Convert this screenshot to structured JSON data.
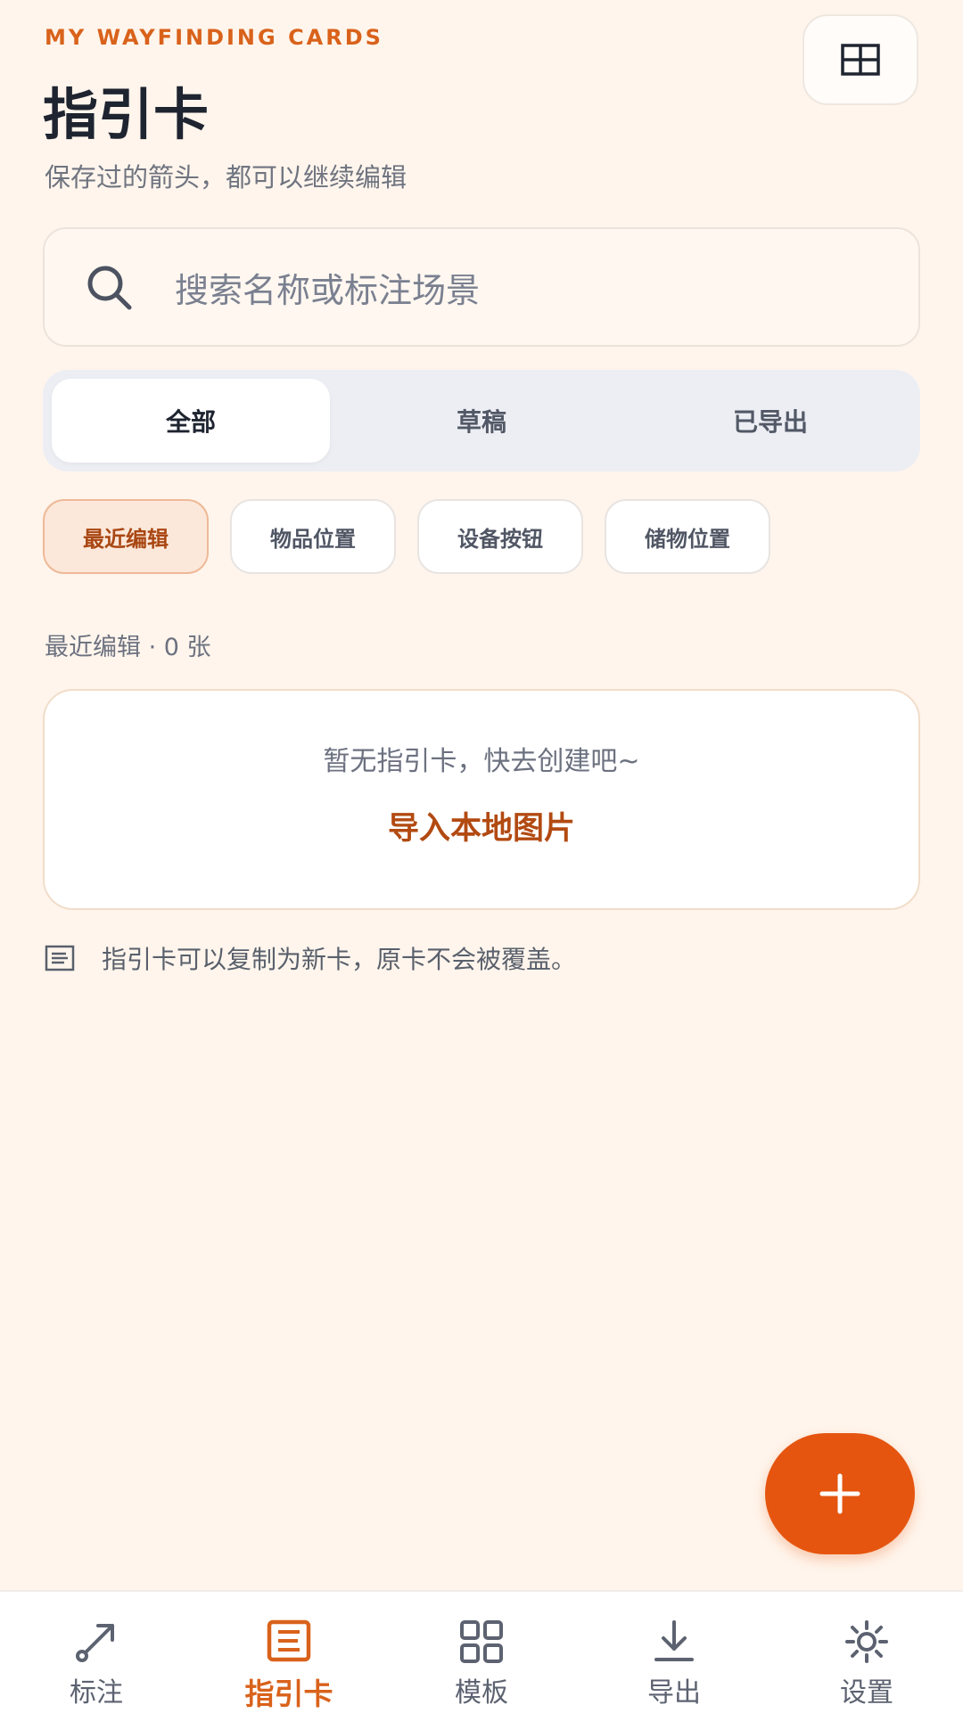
{
  "header": {
    "eyebrow": "MY WAYFINDING CARDS",
    "title": "指引卡",
    "subtitle": "保存过的箭头，都可以继续编辑",
    "layout_icon": "layout-grid-icon"
  },
  "search": {
    "placeholder": "搜索名称或标注场景",
    "icon": "search-icon"
  },
  "segments": [
    {
      "label": "全部",
      "active": true
    },
    {
      "label": "草稿",
      "active": false
    },
    {
      "label": "已导出",
      "active": false
    }
  ],
  "chips": [
    {
      "label": "最近编辑",
      "active": true
    },
    {
      "label": "物品位置",
      "active": false
    },
    {
      "label": "设备按钮",
      "active": false
    },
    {
      "label": "储物位置",
      "active": false
    }
  ],
  "list": {
    "count_text": "最近编辑 · 0 张",
    "empty_message": "暂无指引卡，快去创建吧~",
    "import_label": "导入本地图片"
  },
  "hint": {
    "text": "指引卡可以复制为新卡，原卡不会被覆盖。",
    "icon": "document-lines-icon"
  },
  "fab": {
    "icon": "plus-icon"
  },
  "nav": [
    {
      "label": "标注",
      "icon": "arrow-annotate-icon",
      "active": false
    },
    {
      "label": "指引卡",
      "icon": "card-list-icon",
      "active": true
    },
    {
      "label": "模板",
      "icon": "grid-templates-icon",
      "active": false
    },
    {
      "label": "导出",
      "icon": "download-icon",
      "active": false
    },
    {
      "label": "设置",
      "icon": "settings-gear-icon",
      "active": false
    }
  ],
  "colors": {
    "accent": "#E5550F",
    "accent_text": "#D9621B",
    "background": "#FFF5EC",
    "chip_active_bg": "#FCE8DA"
  }
}
